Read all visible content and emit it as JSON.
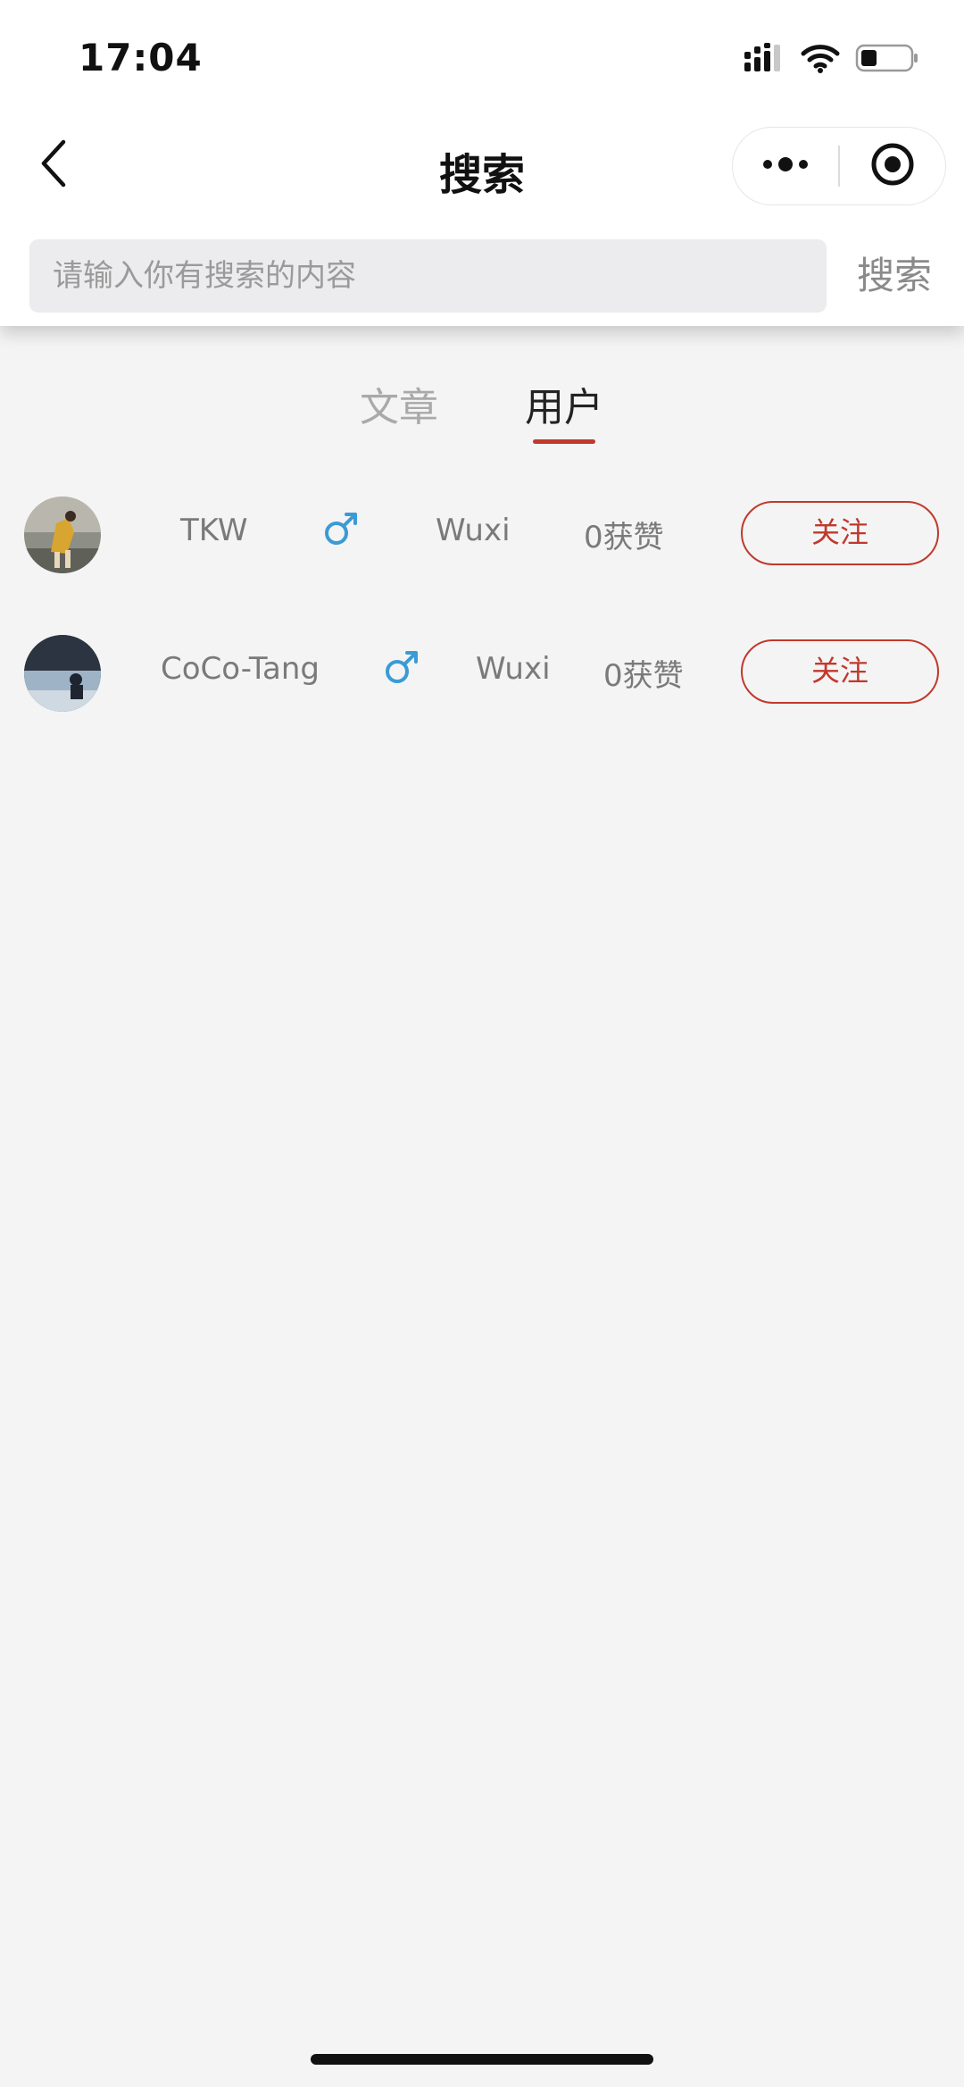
{
  "status_bar": {
    "time": "17:04",
    "icons": [
      "cellular-signal-icon",
      "wifi-icon",
      "battery-icon"
    ]
  },
  "nav": {
    "title": "搜索",
    "back_icon": "chevron-left-icon",
    "more_icon": "more-dots-icon",
    "close_icon": "target-circle-icon"
  },
  "search": {
    "placeholder": "请输入你有搜索的内容",
    "value": "",
    "button_label": "搜索"
  },
  "tabs": [
    {
      "label": "文章",
      "active": false
    },
    {
      "label": "用户",
      "active": true
    }
  ],
  "users": [
    {
      "name": "TKW",
      "gender_icon": "male-symbol-icon",
      "location": "Wuxi",
      "likes": "0获赞",
      "follow_label": "关注"
    },
    {
      "name": "CoCo-Tang",
      "gender_icon": "male-symbol-icon",
      "location": "Wuxi",
      "likes": "0获赞",
      "follow_label": "关注"
    }
  ],
  "colors": {
    "accent_red": "#c0392b",
    "gender_blue": "#3a9bd5",
    "background": "#f4f4f5"
  }
}
